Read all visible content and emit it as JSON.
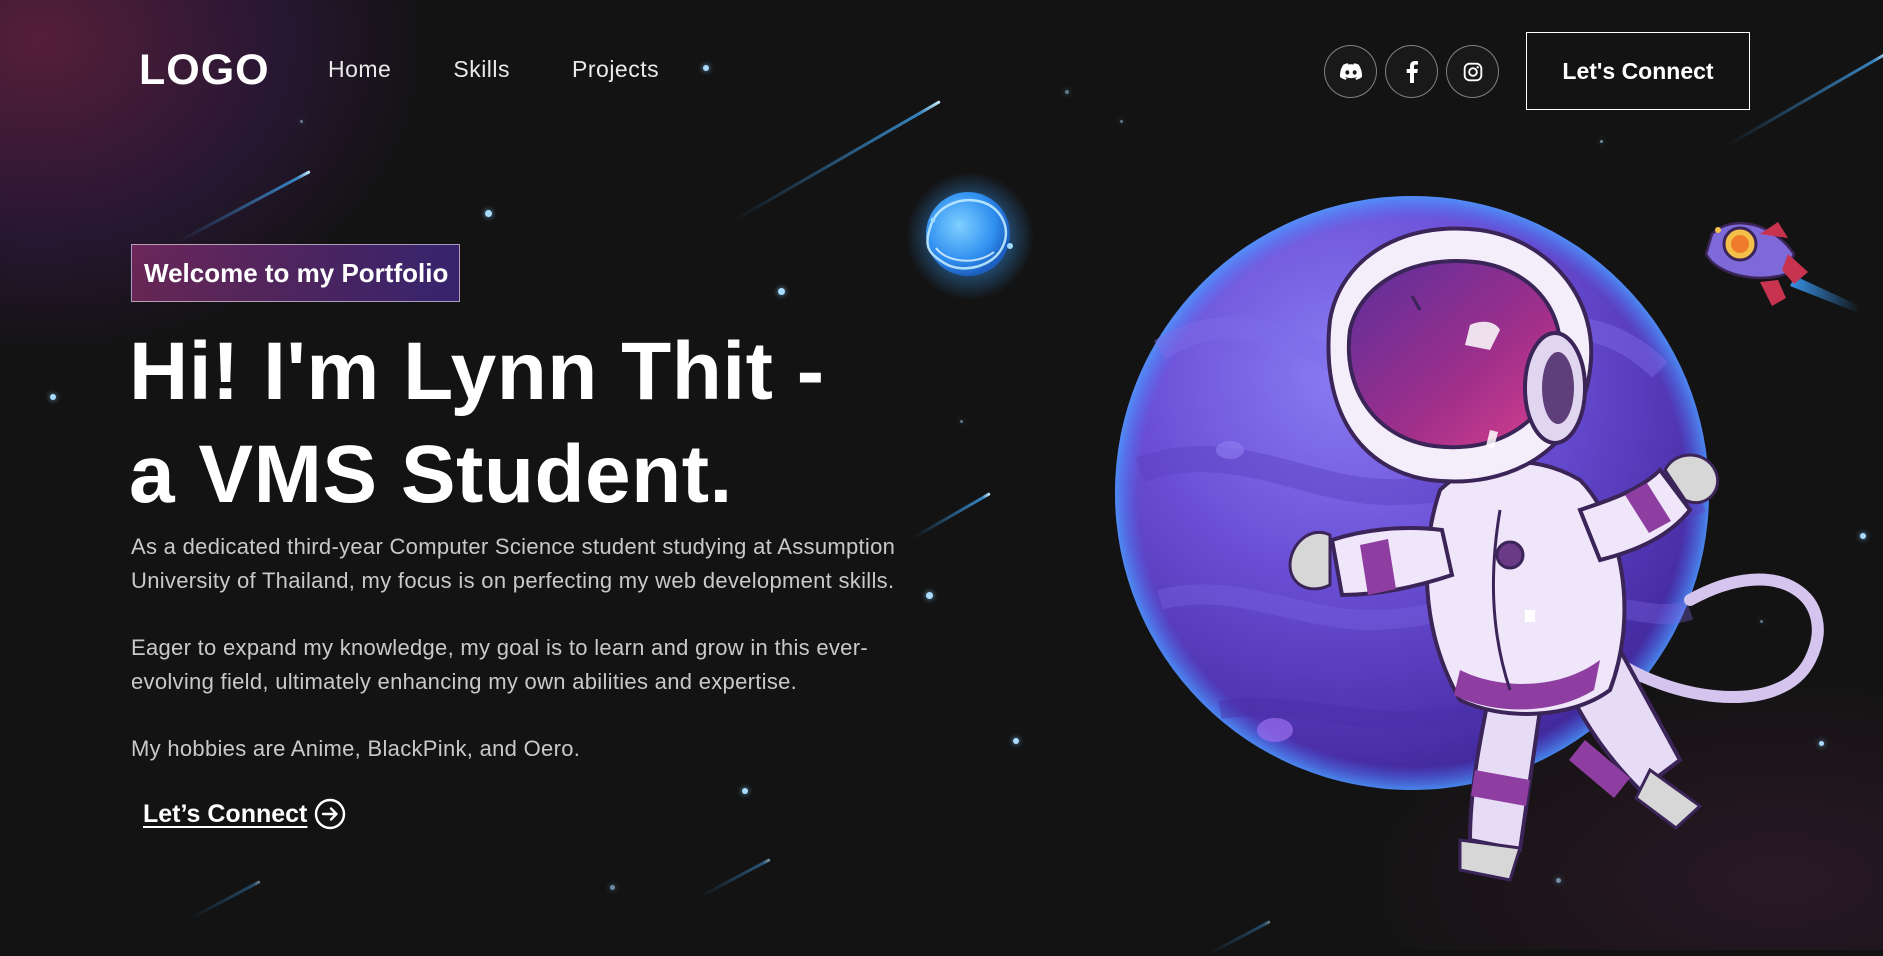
{
  "navbar": {
    "logo": "LOGO",
    "links": [
      {
        "label": "Home"
      },
      {
        "label": "Skills"
      },
      {
        "label": "Projects"
      }
    ],
    "social": [
      {
        "icon": "discord-icon"
      },
      {
        "icon": "facebook-icon"
      },
      {
        "icon": "instagram-icon"
      }
    ],
    "connect_label": "Let's Connect"
  },
  "hero": {
    "tagline": "Welcome to my Portfolio",
    "title_lines": [
      "Hi! I'm Lynn Thit -",
      "a VMS Student."
    ],
    "paragraphs": [
      {
        "lines": [
          "As a dedicated third-year Computer Science student studying at Assumption",
          "University of Thailand, my focus is on perfecting my web development skills."
        ]
      },
      {
        "lines": [
          "Eager to expand my knowledge, my goal is to learn and grow in this ever-",
          "evolving field, ultimately enhancing my own abilities and expertise."
        ]
      },
      {
        "lines": [
          "My hobbies are Anime, BlackPink, and Oero."
        ]
      }
    ],
    "cta_label": "Let’s Connect"
  },
  "illustration": {
    "icons": [
      "astronaut-icon",
      "planet-icon",
      "rocket-icon",
      "blue-planet-icon"
    ]
  },
  "colors": {
    "background": "#121212",
    "tagline_gradient_start": "#aa367c",
    "tagline_gradient_end": "#4a2fbd",
    "planet": "#6a4fd6",
    "text_muted": "#c9c9c9",
    "star": "#a9dcff"
  }
}
